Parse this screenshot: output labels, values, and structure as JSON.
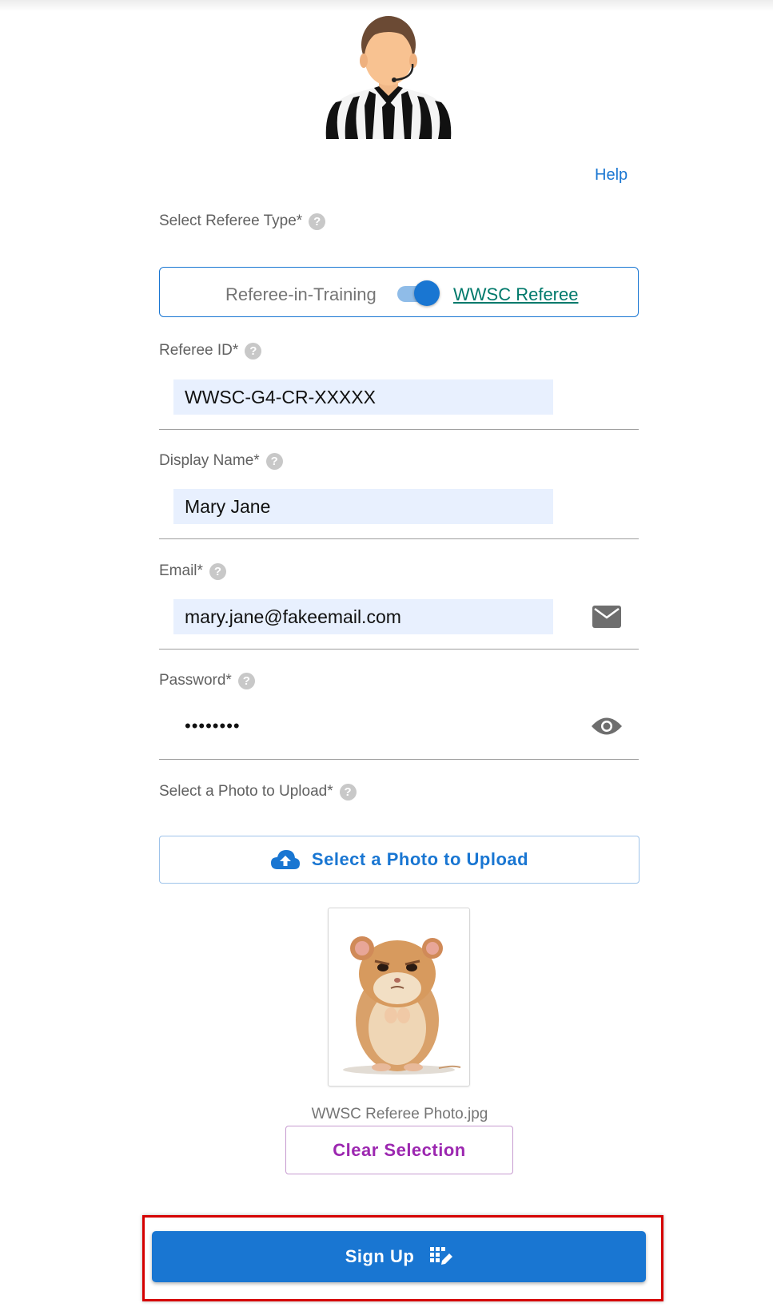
{
  "header": {
    "avatar_icon": "referee-avatar",
    "help_label": "Help"
  },
  "referee_type": {
    "label": "Select Referee Type*",
    "option_left": "Referee-in-Training",
    "option_right": "WWSC Referee",
    "selected": "WWSC Referee"
  },
  "referee_id": {
    "label": "Referee ID*",
    "value": "WWSC-G4-CR-XXXXX"
  },
  "display_name": {
    "label": "Display Name*",
    "value": "Mary Jane"
  },
  "email": {
    "label": "Email*",
    "value": "mary.jane@fakeemail.com",
    "icon": "mail-icon"
  },
  "password": {
    "label": "Password*",
    "value": "••••••••",
    "icon": "eye-icon"
  },
  "photo": {
    "label": "Select a Photo to Upload*",
    "upload_button": "Select a Photo to Upload",
    "upload_icon": "cloud-upload-icon",
    "filename": "WWSC Referee Photo.jpg",
    "clear_button": "Clear Selection"
  },
  "signup": {
    "label": "Sign Up",
    "icon": "signup-icon"
  },
  "colors": {
    "primary": "#1976d2",
    "secondary": "#9c27b0",
    "link": "#00796b",
    "field_bg": "#e8f0fe",
    "highlight": "#d50000"
  }
}
